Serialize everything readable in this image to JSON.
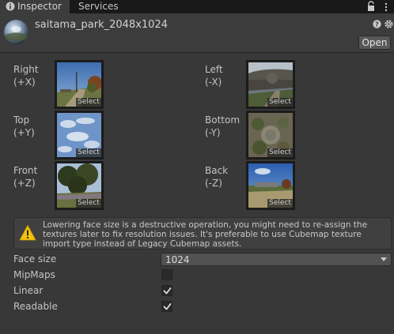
{
  "tabs": {
    "inspector": "Inspector",
    "services": "Services"
  },
  "header": {
    "title": "saitama_park_2048x1024",
    "open_label": "Open"
  },
  "faces": [
    {
      "label": "Right\n(+X)",
      "select": "Select"
    },
    {
      "label": "Left\n(-X)",
      "select": "Select"
    },
    {
      "label": "Top\n(+Y)",
      "select": "Select"
    },
    {
      "label": "Bottom\n(-Y)",
      "select": "Select"
    },
    {
      "label": "Front\n(+Z)",
      "select": "Select"
    },
    {
      "label": "Back\n(-Z)",
      "select": "Select"
    }
  ],
  "warning": {
    "text": "Lowering face size is a destructive operation, you might need to re-assign the textures later to fix resolution issues. It's preferable to use Cubemap texture import type instead of Legacy Cubemap assets."
  },
  "properties": {
    "face_size": {
      "label": "Face size",
      "value": "1024"
    },
    "mipmaps": {
      "label": "MipMaps",
      "checked": false
    },
    "linear": {
      "label": "Linear",
      "checked": true
    },
    "readable": {
      "label": "Readable",
      "checked": true
    }
  },
  "colors": {
    "panel": "#383838",
    "tabbar": "#191919",
    "warning_icon": "#f4c20d"
  }
}
